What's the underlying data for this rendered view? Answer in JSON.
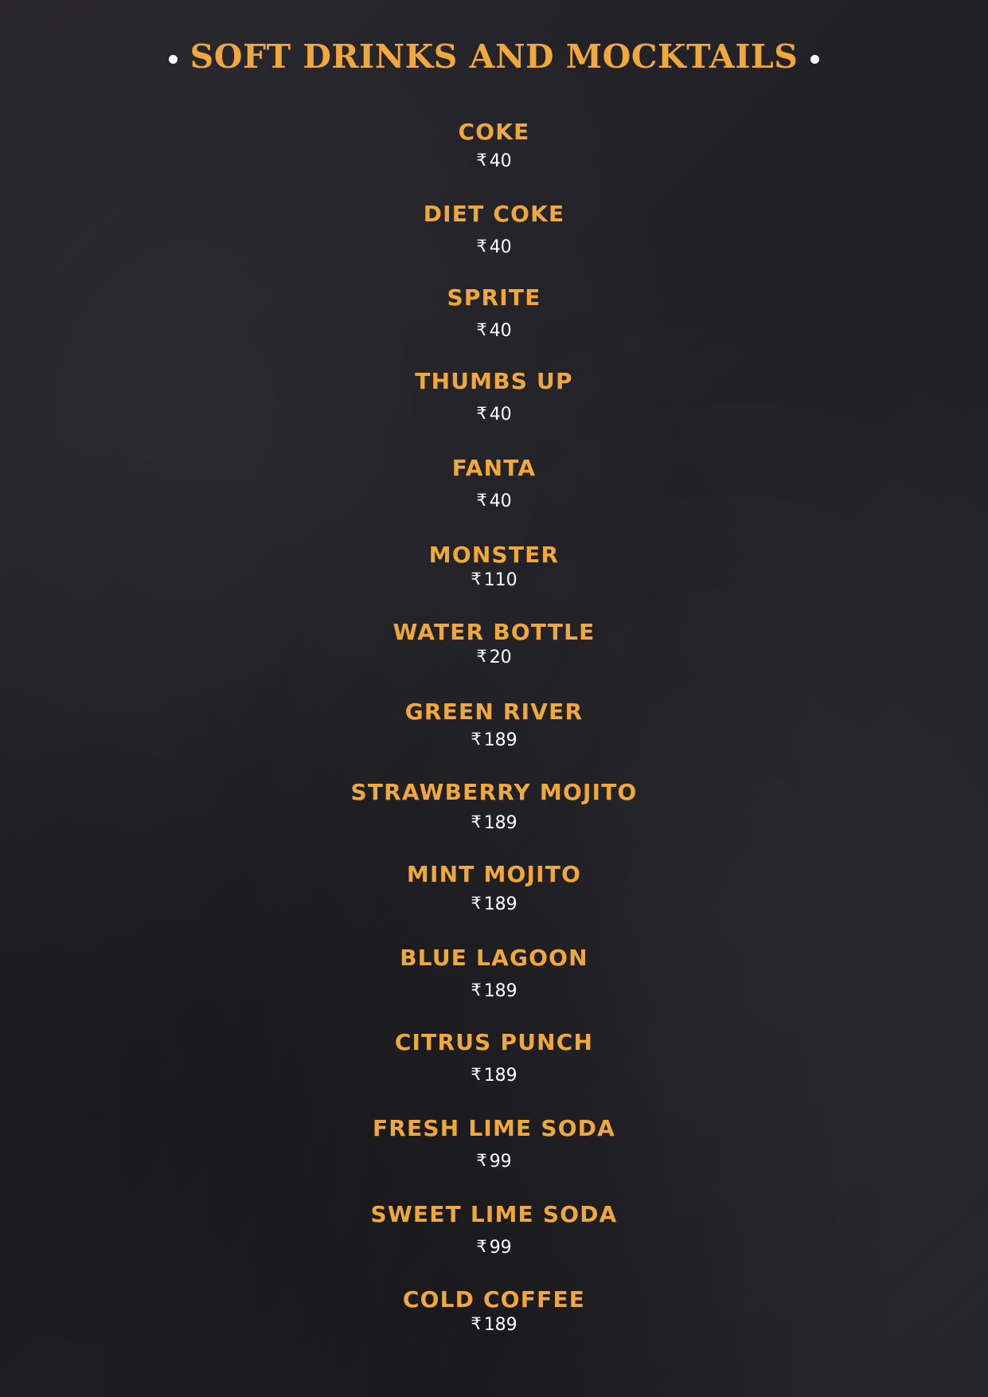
{
  "title": "SOFT DRINKS AND MOCKTAILS",
  "currency_symbol": "₹",
  "colors": {
    "heading": "#f0a83c",
    "price": "#ffffff",
    "background": "#232228"
  },
  "items": [
    {
      "name": "COKE",
      "price": "40"
    },
    {
      "name": "DIET COKE",
      "price": "40"
    },
    {
      "name": "SPRITE",
      "price": "40"
    },
    {
      "name": "THUMBS UP",
      "price": "40"
    },
    {
      "name": "FANTA",
      "price": "40"
    },
    {
      "name": "MONSTER",
      "price": "110"
    },
    {
      "name": "WATER BOTTLE",
      "price": "20"
    },
    {
      "name": "GREEN RIVER",
      "price": "189"
    },
    {
      "name": "STRAWBERRY MOJITO",
      "price": "189"
    },
    {
      "name": "MINT MOJITO",
      "price": "189"
    },
    {
      "name": "BLUE LAGOON",
      "price": "189"
    },
    {
      "name": "CITRUS PUNCH",
      "price": "189"
    },
    {
      "name": "FRESH LIME SODA",
      "price": "99"
    },
    {
      "name": "SWEET LIME SODA",
      "price": "99"
    },
    {
      "name": "COLD COFFEE",
      "price": "189"
    }
  ]
}
